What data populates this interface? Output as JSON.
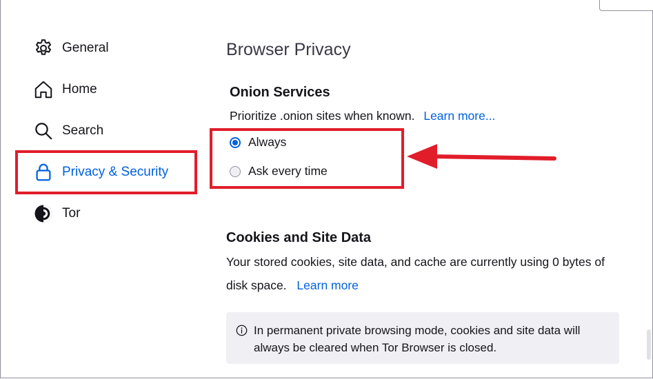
{
  "sidebar": {
    "items": [
      {
        "label": "General",
        "icon": "gear-icon"
      },
      {
        "label": "Home",
        "icon": "home-icon"
      },
      {
        "label": "Search",
        "icon": "search-icon"
      },
      {
        "label": "Privacy & Security",
        "icon": "lock-icon",
        "active": true
      },
      {
        "label": "Tor",
        "icon": "tor-onion-icon"
      }
    ]
  },
  "main": {
    "title": "Browser Privacy",
    "onion": {
      "heading": "Onion Services",
      "description": "Prioritize .onion sites when known.",
      "learn_more": "Learn more...",
      "options": [
        {
          "label": "Always",
          "selected": true
        },
        {
          "label": "Ask every time",
          "selected": false
        }
      ]
    },
    "cookies": {
      "heading": "Cookies and Site Data",
      "line1": "Your stored cookies, site data, and cache are currently using 0 bytes of",
      "line2": "disk space.",
      "learn_more": "Learn more",
      "info": "In permanent private browsing mode, cookies and site data will always be cleared when Tor Browser is closed."
    }
  },
  "colors": {
    "accent": "#0061e0",
    "annotation": "#e11d2a",
    "info_background": "#f0f0f4"
  }
}
